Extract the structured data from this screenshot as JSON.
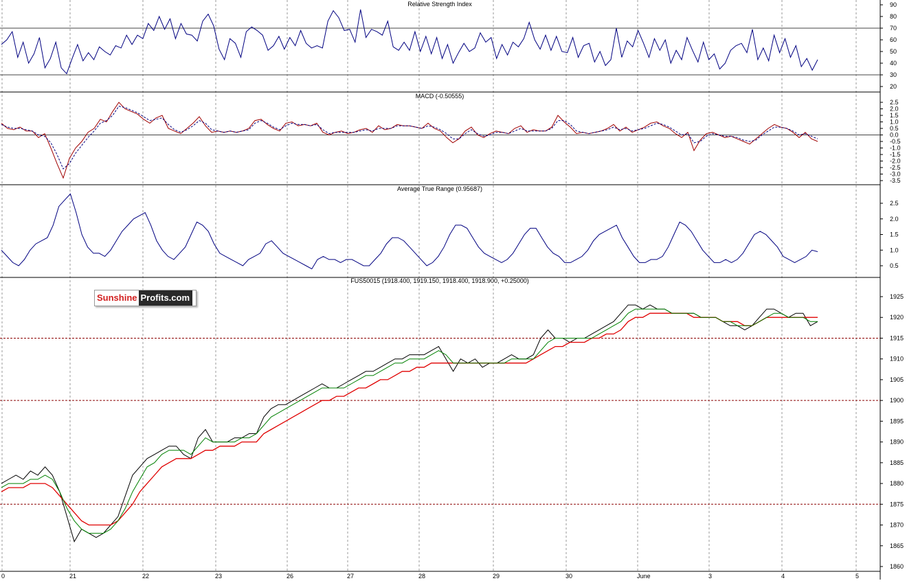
{
  "logo": {
    "part1": "Sunshine",
    "part2": "Profits.com"
  },
  "x_axis": {
    "labels": [
      "0",
      "21",
      "22",
      "23",
      "26",
      "27",
      "28",
      "29",
      "30",
      "June",
      "3",
      "4",
      "5"
    ]
  },
  "colors": {
    "price": "#000000",
    "rsi": "#000080",
    "macd": "#a00000",
    "macd_signal": "#000080",
    "atr": "#000080",
    "ma_fast": "#008000",
    "ma_slow": "#e00000",
    "ref_line": "#8b0000",
    "grid": "#9a9a9a"
  },
  "chart_data": [
    {
      "type": "line",
      "title": "Relative Strength Index",
      "yticks": [
        "90",
        "80",
        "70",
        "60",
        "50",
        "40",
        "30",
        "20"
      ],
      "ylim": [
        15,
        95
      ],
      "reference_lines": [
        70,
        30
      ],
      "series": [
        {
          "values": [
            56,
            60,
            67,
            45,
            58,
            40,
            48,
            62,
            36,
            44,
            58,
            36,
            31,
            44,
            56,
            42,
            49,
            43,
            54,
            50,
            47,
            55,
            53,
            64,
            56,
            64,
            61,
            74,
            68,
            80,
            69,
            78,
            61,
            74,
            65,
            64,
            59,
            76,
            82,
            72,
            52,
            43,
            61,
            57,
            45,
            67,
            71,
            68,
            64,
            51,
            55,
            63,
            52,
            62,
            55,
            68,
            57,
            53,
            55,
            53,
            76,
            85,
            79,
            68,
            69,
            58,
            86,
            62,
            69,
            67,
            64,
            76,
            54,
            51,
            58,
            51,
            67,
            50,
            63,
            48,
            62,
            44,
            56,
            40,
            49,
            57,
            50,
            53,
            66,
            58,
            62,
            44,
            56,
            47,
            58,
            54,
            61,
            75,
            60,
            52,
            64,
            51,
            63,
            50,
            49,
            62,
            45,
            55,
            57,
            41,
            50,
            38,
            43,
            70,
            45,
            59,
            54,
            68,
            57,
            45,
            61,
            51,
            60,
            40,
            51,
            43,
            62,
            51,
            41,
            58,
            43,
            48,
            35,
            40,
            51,
            55,
            57,
            49,
            69,
            43,
            53,
            42,
            64,
            49,
            61,
            45,
            55,
            37,
            44,
            34,
            43
          ]
        }
      ]
    },
    {
      "type": "line",
      "title": "MACD (-0.50555)",
      "yticks": [
        "2.5",
        "2.0",
        "1.5",
        "1.0",
        "0.5",
        "0.0",
        "-0.5",
        "-1.0",
        "-1.5",
        "-2.0",
        "-2.5",
        "-3.0",
        "-3.5"
      ],
      "ylim": [
        -3.8,
        2.8
      ],
      "series": [
        {
          "name": "MACD",
          "values": [
            0.9,
            0.5,
            0.4,
            0.6,
            0.3,
            0.3,
            -0.2,
            0.1,
            -1.0,
            -2.2,
            -3.3,
            -1.8,
            -1.0,
            -0.5,
            0.2,
            0.5,
            1.2,
            1.0,
            1.8,
            2.5,
            2.0,
            1.8,
            1.6,
            1.2,
            0.9,
            1.3,
            1.5,
            0.5,
            0.3,
            0.1,
            0.5,
            0.9,
            1.4,
            0.7,
            0.2,
            0.3,
            0.2,
            0.3,
            0.2,
            0.3,
            0.5,
            1.1,
            1.2,
            0.8,
            0.5,
            0.3,
            0.9,
            1.0,
            0.7,
            0.8,
            0.7,
            0.9,
            0.2,
            0.0,
            0.2,
            0.3,
            0.1,
            0.2,
            0.4,
            0.5,
            0.2,
            0.7,
            0.4,
            0.5,
            0.8,
            0.7,
            0.7,
            0.6,
            0.5,
            0.9,
            0.5,
            0.3,
            -0.2,
            -0.6,
            -0.3,
            0.3,
            0.6,
            0.0,
            -0.2,
            0.1,
            0.3,
            0.2,
            0.1,
            0.5,
            0.7,
            0.2,
            0.4,
            0.3,
            0.3,
            0.6,
            1.5,
            1.0,
            0.6,
            0.1,
            0.2,
            0.1,
            0.2,
            0.3,
            0.5,
            0.8,
            0.3,
            0.6,
            0.2,
            0.4,
            0.6,
            0.9,
            1.0,
            0.7,
            0.5,
            0.1,
            -0.2,
            0.2,
            -1.2,
            -0.4,
            0.1,
            0.2,
            0.0,
            -0.2,
            -0.1,
            -0.3,
            -0.5,
            -0.7,
            -0.3,
            0.1,
            0.5,
            0.8,
            0.6,
            0.5,
            0.2,
            -0.2,
            0.2,
            -0.3,
            -0.5
          ]
        },
        {
          "name": "Signal",
          "values": [
            0.8,
            0.6,
            0.5,
            0.5,
            0.4,
            0.3,
            0.0,
            -0.1,
            -0.6,
            -1.5,
            -2.6,
            -2.2,
            -1.4,
            -0.8,
            -0.2,
            0.3,
            0.9,
            1.1,
            1.5,
            2.2,
            2.1,
            1.9,
            1.7,
            1.4,
            1.1,
            1.2,
            1.3,
            0.8,
            0.4,
            0.2,
            0.4,
            0.7,
            1.1,
            0.9,
            0.4,
            0.3,
            0.2,
            0.3,
            0.2,
            0.3,
            0.4,
            0.9,
            1.1,
            0.9,
            0.6,
            0.4,
            0.7,
            0.9,
            0.8,
            0.8,
            0.7,
            0.8,
            0.4,
            0.1,
            0.2,
            0.2,
            0.2,
            0.2,
            0.3,
            0.4,
            0.3,
            0.5,
            0.5,
            0.5,
            0.7,
            0.7,
            0.7,
            0.6,
            0.5,
            0.7,
            0.6,
            0.4,
            0.1,
            -0.3,
            -0.3,
            0.1,
            0.4,
            0.1,
            -0.1,
            0.0,
            0.2,
            0.2,
            0.1,
            0.3,
            0.5,
            0.3,
            0.3,
            0.3,
            0.3,
            0.5,
            1.1,
            1.1,
            0.8,
            0.3,
            0.2,
            0.1,
            0.2,
            0.3,
            0.4,
            0.6,
            0.4,
            0.5,
            0.3,
            0.4,
            0.5,
            0.7,
            0.9,
            0.8,
            0.6,
            0.3,
            0.0,
            0.1,
            -0.6,
            -0.5,
            -0.1,
            0.1,
            0.0,
            -0.1,
            -0.1,
            -0.2,
            -0.4,
            -0.5,
            -0.4,
            0.0,
            0.3,
            0.6,
            0.6,
            0.5,
            0.3,
            0.0,
            0.1,
            -0.1,
            -0.3
          ]
        }
      ],
      "reference_lines": [
        0
      ]
    },
    {
      "type": "line",
      "title": "Average True Range (0.95687)",
      "yticks": [
        "2.5",
        "2.0",
        "1.5",
        "1.0",
        "0.5"
      ],
      "ylim": [
        0.05,
        2.85
      ],
      "series": [
        {
          "values": [
            1.0,
            0.8,
            0.6,
            0.5,
            0.7,
            1.0,
            1.2,
            1.3,
            1.4,
            1.8,
            2.4,
            2.6,
            2.8,
            2.2,
            1.5,
            1.1,
            0.9,
            0.9,
            0.8,
            1.0,
            1.3,
            1.6,
            1.8,
            2.0,
            2.1,
            2.2,
            1.8,
            1.3,
            1.0,
            0.8,
            0.7,
            0.9,
            1.1,
            1.5,
            1.9,
            1.8,
            1.6,
            1.2,
            0.9,
            0.8,
            0.7,
            0.6,
            0.5,
            0.7,
            0.8,
            0.9,
            1.2,
            1.3,
            1.1,
            0.9,
            0.8,
            0.7,
            0.6,
            0.5,
            0.4,
            0.7,
            0.8,
            0.7,
            0.7,
            0.6,
            0.7,
            0.7,
            0.6,
            0.5,
            0.5,
            0.7,
            0.9,
            1.2,
            1.4,
            1.4,
            1.3,
            1.1,
            0.9,
            0.7,
            0.5,
            0.6,
            0.8,
            1.1,
            1.5,
            1.8,
            1.8,
            1.7,
            1.4,
            1.1,
            0.9,
            0.8,
            0.7,
            0.6,
            0.7,
            0.9,
            1.2,
            1.5,
            1.7,
            1.7,
            1.4,
            1.1,
            0.9,
            0.8,
            0.6,
            0.6,
            0.7,
            0.8,
            1.0,
            1.3,
            1.5,
            1.6,
            1.7,
            1.8,
            1.4,
            1.1,
            0.8,
            0.6,
            0.6,
            0.7,
            0.7,
            0.8,
            1.1,
            1.5,
            1.9,
            1.8,
            1.6,
            1.3,
            1.0,
            0.8,
            0.6,
            0.6,
            0.7,
            0.6,
            0.7,
            0.9,
            1.2,
            1.5,
            1.6,
            1.5,
            1.3,
            1.1,
            0.8,
            0.7,
            0.6,
            0.7,
            0.8,
            1.0,
            0.95
          ]
        }
      ]
    },
    {
      "type": "line",
      "title": "FUS50015 (1918.400, 1919.150, 1918.400, 1918.900, +0.25000)",
      "yticks": [
        "1925",
        "1920",
        "1915",
        "1910",
        "1905",
        "1900",
        "1895",
        "1890",
        "1885",
        "1880",
        "1875",
        "1870",
        "1865",
        "1860"
      ],
      "ylim": [
        1858.8,
        1928.3
      ],
      "reference_lines": [
        1915,
        1900,
        1875
      ],
      "series": [
        {
          "values": [
            1880,
            1881,
            1882,
            1881,
            1883,
            1882,
            1884,
            1882,
            1878,
            1872,
            1866,
            1869,
            1868,
            1867,
            1868,
            1870,
            1872,
            1877,
            1882,
            1884,
            1886,
            1887,
            1888,
            1889,
            1889,
            1887,
            1886,
            1891,
            1893,
            1890,
            1890,
            1890,
            1891,
            1891,
            1892,
            1892,
            1896,
            1898,
            1899,
            1899,
            1900,
            1901,
            1902,
            1903,
            1904,
            1903,
            1903,
            1904,
            1905,
            1906,
            1907,
            1907,
            1908,
            1909,
            1910,
            1910,
            1911,
            1911,
            1911,
            1912,
            1913,
            1910,
            1907,
            1910,
            1909,
            1910,
            1908,
            1909,
            1909,
            1910,
            1911,
            1910,
            1910,
            1911,
            1915,
            1917,
            1915,
            1915,
            1914,
            1915,
            1915,
            1916,
            1917,
            1918,
            1919,
            1921,
            1923,
            1923,
            1922,
            1923,
            1922,
            1922,
            1921,
            1921,
            1921,
            1921,
            1920,
            1920,
            1920,
            1919,
            1918,
            1918,
            1917,
            1918,
            1920,
            1922,
            1922,
            1921,
            1920,
            1921,
            1921,
            1918,
            1919
          ]
        },
        {
          "name": "",
          "values": [
            1879,
            1880,
            1880,
            1880,
            1881,
            1881,
            1882,
            1881,
            1878,
            1874,
            1871,
            1869,
            1868,
            1868,
            1868,
            1869,
            1871,
            1874,
            1878,
            1881,
            1884,
            1885,
            1887,
            1888,
            1888,
            1888,
            1887,
            1889,
            1891,
            1890,
            1890,
            1890,
            1890,
            1891,
            1891,
            1892,
            1894,
            1896,
            1897,
            1898,
            1899,
            1900,
            1901,
            1902,
            1903,
            1903,
            1903,
            1903,
            1904,
            1905,
            1906,
            1906,
            1907,
            1908,
            1909,
            1909,
            1910,
            1910,
            1910,
            1911,
            1912,
            1911,
            1909,
            1909,
            1909,
            1909,
            1909,
            1909,
            1909,
            1909,
            1910,
            1910,
            1910,
            1910,
            1912,
            1914,
            1915,
            1915,
            1915,
            1915,
            1915,
            1915,
            1916,
            1917,
            1918,
            1919,
            1921,
            1922,
            1922,
            1922,
            1922,
            1922,
            1921,
            1921,
            1921,
            1921,
            1920,
            1920,
            1920,
            1919,
            1919,
            1918,
            1918,
            1918,
            1919,
            1920,
            1921,
            1921,
            1920,
            1920,
            1920,
            1919,
            1919
          ]
        },
        {
          "name": "",
          "values": [
            1878,
            1879,
            1879,
            1879,
            1880,
            1880,
            1880,
            1879,
            1877,
            1875,
            1873,
            1871,
            1870,
            1870,
            1870,
            1870,
            1871,
            1873,
            1875,
            1878,
            1880,
            1882,
            1884,
            1885,
            1886,
            1886,
            1886,
            1887,
            1888,
            1888,
            1889,
            1889,
            1889,
            1890,
            1890,
            1890,
            1892,
            1893,
            1894,
            1895,
            1896,
            1897,
            1898,
            1899,
            1900,
            1900,
            1901,
            1901,
            1902,
            1903,
            1903,
            1904,
            1905,
            1905,
            1906,
            1907,
            1907,
            1908,
            1908,
            1909,
            1909,
            1909,
            1909,
            1909,
            1909,
            1909,
            1909,
            1909,
            1909,
            1909,
            1909,
            1909,
            1909,
            1910,
            1911,
            1912,
            1913,
            1913,
            1914,
            1914,
            1914,
            1915,
            1915,
            1916,
            1916,
            1917,
            1919,
            1920,
            1920,
            1921,
            1921,
            1921,
            1921,
            1921,
            1921,
            1920,
            1920,
            1920,
            1920,
            1919,
            1919,
            1919,
            1918,
            1918,
            1919,
            1920,
            1920,
            1920,
            1920,
            1920,
            1920,
            1920,
            1920
          ]
        }
      ]
    }
  ]
}
